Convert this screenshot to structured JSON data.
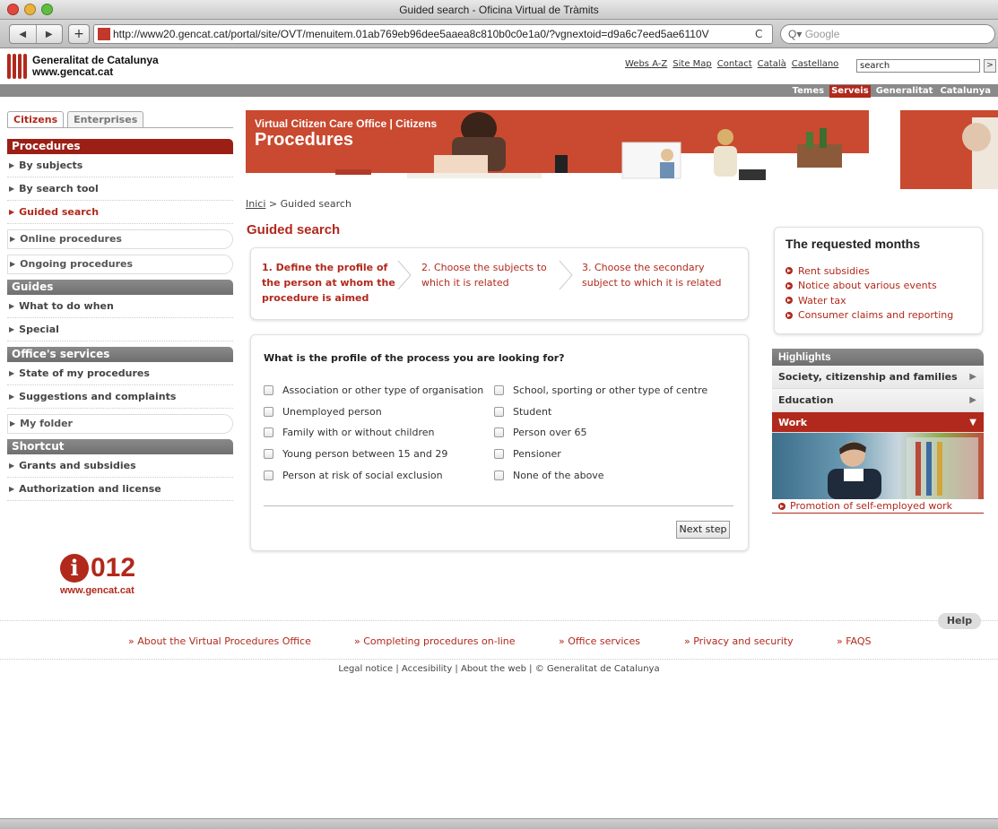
{
  "window": {
    "title": "Guided search - Oficina Virtual de Tràmits"
  },
  "browser": {
    "url": "http://www20.gencat.cat/portal/site/OVT/menuitem.01ab769eb96dee5aaea8c810b0c0e1a0/?vgnextoid=d9a6c7eed5ae6110V",
    "search_placeholder": "Google",
    "back": "◀",
    "forward": "▶",
    "add": "+",
    "reload": "C"
  },
  "header": {
    "brand_line1": "Generalitat de Catalunya",
    "brand_line2": "www.gencat.cat",
    "links": [
      "Webs A-Z",
      "Site Map",
      "Contact",
      "Català",
      "Castellano"
    ],
    "search_value": "search",
    "search_go": ">",
    "nav": [
      "Temes",
      "Serveis",
      "Generalitat",
      "Catalunya"
    ]
  },
  "sidebar": {
    "tabs": [
      "Citizens",
      "Enterprises"
    ],
    "procedures_title": "Procedures",
    "procedures": [
      "By subjects",
      "By search tool",
      "Guided search"
    ],
    "pills": [
      "Online procedures",
      "Ongoing procedures"
    ],
    "guides_title": "Guides",
    "guides": [
      "What to do when",
      "Special"
    ],
    "office_title": "Office's services",
    "office": [
      "State of my procedures",
      "Suggestions and complaints"
    ],
    "folder": "My folder",
    "shortcut_title": "Shortcut",
    "shortcut": [
      "Grants and subsidies",
      "Authorization and license"
    ],
    "logo_num": "012",
    "logo_i": "i",
    "logo_site": "www.gencat.cat"
  },
  "banner": {
    "subtitle": "Virtual Citizen Care Office | Citizens",
    "title": "Procedures"
  },
  "breadcrumb": {
    "home": "Inici",
    "sep": ">",
    "current": "Guided search"
  },
  "main": {
    "title": "Guided search",
    "steps": [
      {
        "label": "1. Define the profile of the person at whom the procedure is aimed"
      },
      {
        "label": "2. Choose the subjects to which it is related"
      },
      {
        "label": "3. Choose the secondary subject to which it is related"
      }
    ],
    "question": "What is the profile of the process you are looking for?",
    "options_left": [
      "Association or other type of organisation",
      "Unemployed person",
      "Family with or without children",
      "Young person between 15 and 29",
      "Person at risk of social exclusion"
    ],
    "options_right": [
      "School, sporting or other type of centre",
      "Student",
      "Person over 65",
      "Pensioner",
      "None of the above"
    ],
    "next_button": "Next step"
  },
  "months": {
    "title": "The requested months",
    "items": [
      "Rent subsidies",
      "Notice about various events",
      "Water tax",
      "Consumer claims and reporting"
    ]
  },
  "highlights": {
    "title": "Highlights",
    "items": [
      "Society, citizenship and families",
      "Education",
      "Work"
    ],
    "arrow": "▶",
    "arrow_down": "▼",
    "link": "Promotion of self-employed work"
  },
  "footer": {
    "help": "Help",
    "links": [
      "» About the Virtual Procedures Office",
      "» Completing procedures on-line",
      "» Office services",
      "» Privacy and security",
      "» FAQS"
    ],
    "legal": "Legal notice | Accesibility | About the web | © Generalitat de Catalunya"
  },
  "colors": {
    "accent": "#b1291c",
    "banner": "#c94a30",
    "gray": "#8a8a8a"
  }
}
